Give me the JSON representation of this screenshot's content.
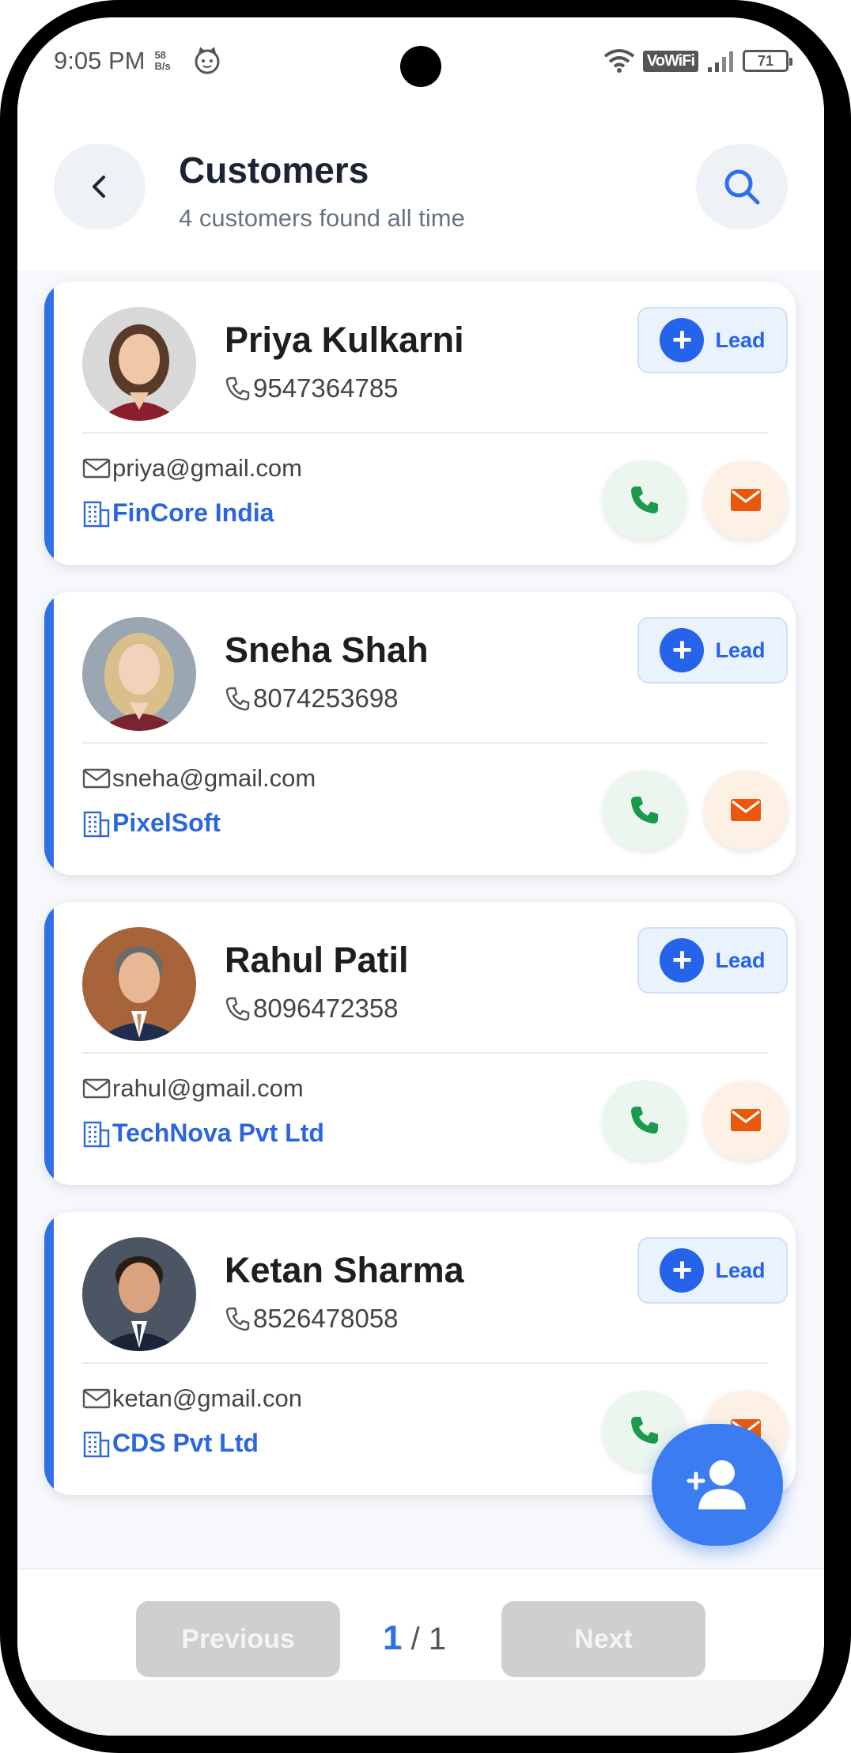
{
  "status_bar": {
    "time": "9:05 PM",
    "net_speed_value": "58",
    "net_speed_unit": "B/s",
    "vowifi": "VoWiFi",
    "battery": "71"
  },
  "header": {
    "title": "Customers",
    "subtitle": "4 customers found all time"
  },
  "customers": [
    {
      "name": "Priya Kulkarni",
      "phone": "9547364785",
      "email": "priya@gmail.com",
      "company": "FinCore India",
      "lead_label": "Lead"
    },
    {
      "name": "Sneha Shah",
      "phone": "8074253698",
      "email": "sneha@gmail.com",
      "company": "PixelSoft",
      "lead_label": "Lead"
    },
    {
      "name": "Rahul Patil",
      "phone": "8096472358",
      "email": "rahul@gmail.com",
      "company": "TechNova Pvt Ltd",
      "lead_label": "Lead"
    },
    {
      "name": "Ketan Sharma",
      "phone": "8526478058",
      "email": "ketan@gmail.con",
      "company": "CDS Pvt Ltd",
      "lead_label": "Lead"
    }
  ],
  "pagination": {
    "previous_label": "Previous",
    "next_label": "Next",
    "current_page": "1",
    "separator": "/",
    "total_pages": "1"
  },
  "colors": {
    "accent": "#2f6fe8",
    "lead_blue": "#2563eb",
    "call_green": "#1a9a4a",
    "mail_orange": "#ea580c",
    "fab_blue": "#3b7cf0"
  }
}
